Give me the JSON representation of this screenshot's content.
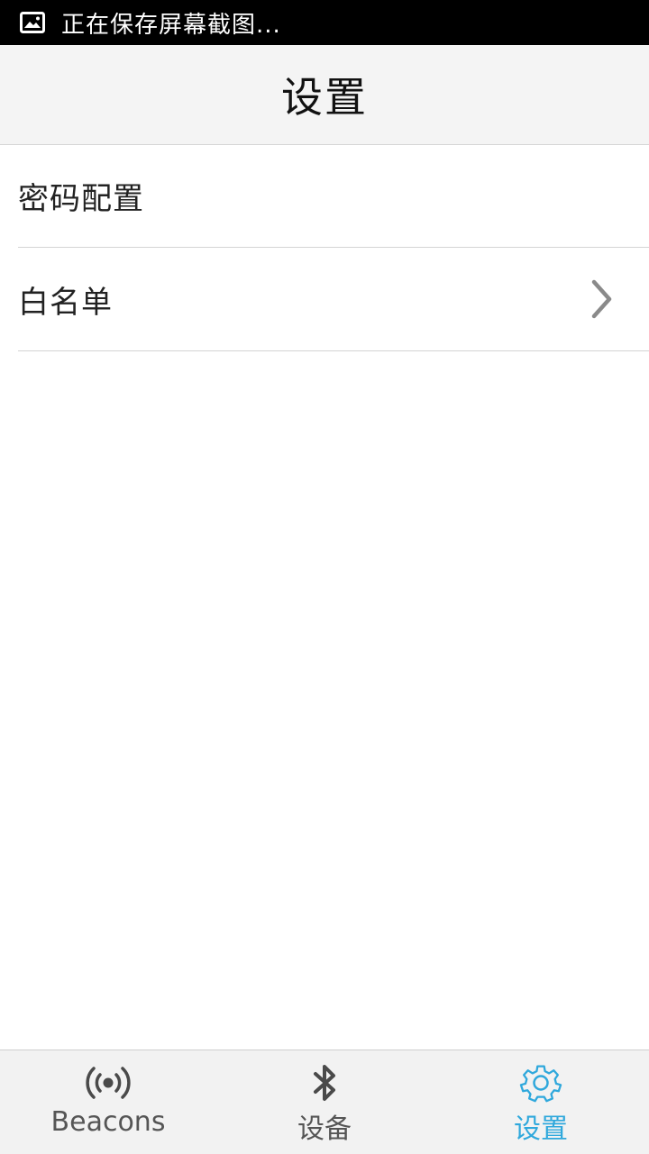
{
  "status_bar": {
    "icon": "image-icon",
    "text": "正在保存屏幕截图..."
  },
  "header": {
    "title": "设置"
  },
  "settings": {
    "items": [
      {
        "label": "密码配置",
        "has_chevron": false
      },
      {
        "label": "白名单",
        "has_chevron": true,
        "icon": "chevron-right-icon"
      }
    ]
  },
  "bottom_nav": {
    "tabs": [
      {
        "label": "Beacons",
        "icon": "broadcast-icon",
        "active": false
      },
      {
        "label": "设备",
        "icon": "bluetooth-icon",
        "active": false
      },
      {
        "label": "设置",
        "icon": "gear-icon",
        "active": true
      }
    ],
    "active_color": "#2fa8dc",
    "inactive_color": "#555555"
  }
}
